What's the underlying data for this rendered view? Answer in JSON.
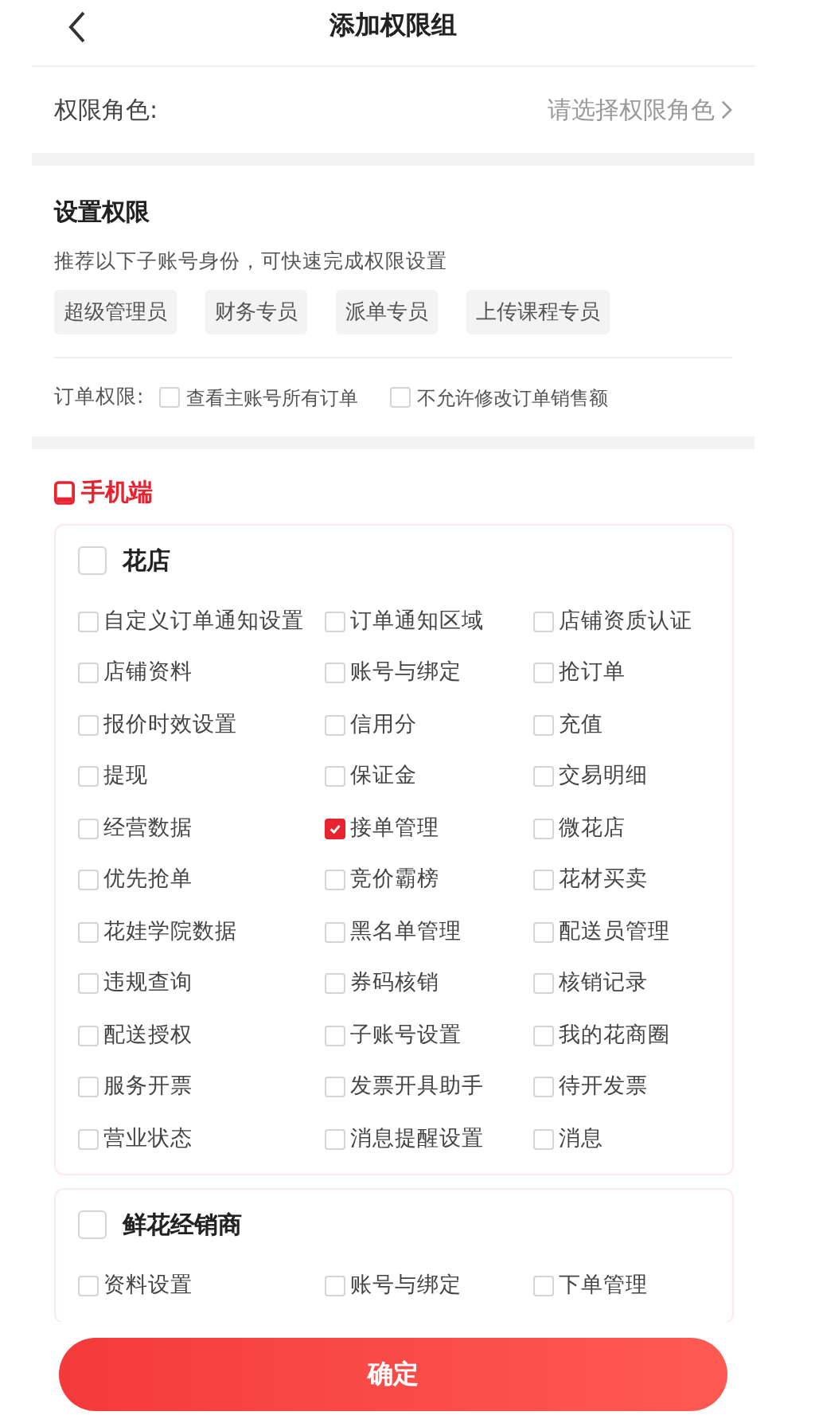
{
  "header": {
    "title": "添加权限组"
  },
  "role": {
    "label": "权限角色:",
    "placeholder": "请选择权限角色"
  },
  "permissions": {
    "title": "设置权限",
    "hint": "推荐以下子账号身份，可快速完成权限设置",
    "presets": [
      "超级管理员",
      "财务专员",
      "派单专员",
      "上传课程专员"
    ],
    "order": {
      "label": "订单权限:",
      "options": [
        {
          "label": "查看主账号所有订单",
          "checked": false
        },
        {
          "label": "不允许修改订单销售额",
          "checked": false
        }
      ]
    }
  },
  "platform": {
    "title": "手机端",
    "groups": [
      {
        "name": "花店",
        "checked": false,
        "items": [
          {
            "label": "自定义订单通知设置",
            "checked": false
          },
          {
            "label": "订单通知区域",
            "checked": false
          },
          {
            "label": "店铺资质认证",
            "checked": false
          },
          {
            "label": "店铺资料",
            "checked": false
          },
          {
            "label": "账号与绑定",
            "checked": false
          },
          {
            "label": "抢订单",
            "checked": false
          },
          {
            "label": "报价时效设置",
            "checked": false
          },
          {
            "label": "信用分",
            "checked": false
          },
          {
            "label": "充值",
            "checked": false
          },
          {
            "label": "提现",
            "checked": false
          },
          {
            "label": "保证金",
            "checked": false
          },
          {
            "label": "交易明细",
            "checked": false
          },
          {
            "label": "经营数据",
            "checked": false
          },
          {
            "label": "接单管理",
            "checked": true
          },
          {
            "label": "微花店",
            "checked": false
          },
          {
            "label": "优先抢单",
            "checked": false
          },
          {
            "label": "竞价霸榜",
            "checked": false
          },
          {
            "label": "花材买卖",
            "checked": false
          },
          {
            "label": "花娃学院数据",
            "checked": false
          },
          {
            "label": "黑名单管理",
            "checked": false
          },
          {
            "label": "配送员管理",
            "checked": false
          },
          {
            "label": "违规查询",
            "checked": false
          },
          {
            "label": "券码核销",
            "checked": false
          },
          {
            "label": "核销记录",
            "checked": false
          },
          {
            "label": "配送授权",
            "checked": false
          },
          {
            "label": "子账号设置",
            "checked": false
          },
          {
            "label": "我的花商圈",
            "checked": false
          },
          {
            "label": "服务开票",
            "checked": false
          },
          {
            "label": "发票开具助手",
            "checked": false
          },
          {
            "label": "待开发票",
            "checked": false
          },
          {
            "label": "营业状态",
            "checked": false
          },
          {
            "label": "消息提醒设置",
            "checked": false
          },
          {
            "label": "消息",
            "checked": false
          }
        ]
      },
      {
        "name": "鲜花经销商",
        "checked": false,
        "items": [
          {
            "label": "资料设置",
            "checked": false
          },
          {
            "label": "账号与绑定",
            "checked": false
          },
          {
            "label": "下单管理",
            "checked": false
          }
        ]
      }
    ]
  },
  "footer": {
    "confirm": "确定"
  }
}
